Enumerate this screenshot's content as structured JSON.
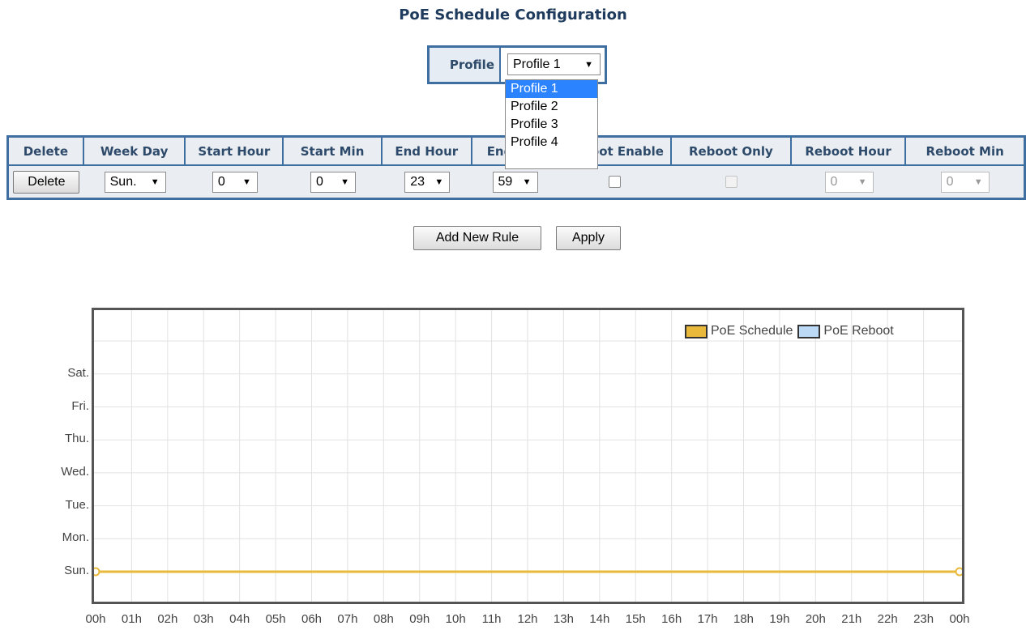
{
  "page": {
    "title": "PoE Schedule Configuration"
  },
  "profile": {
    "label": "Profile",
    "selected": "Profile 1",
    "options": [
      "Profile 1",
      "Profile 2",
      "Profile 3",
      "Profile 4"
    ]
  },
  "table": {
    "headers": [
      "Delete",
      "Week Day",
      "Start Hour",
      "Start Min",
      "End Hour",
      "End Min",
      "Reboot Enable",
      "Reboot Only",
      "Reboot Hour",
      "Reboot Min"
    ],
    "row": {
      "delete_label": "Delete",
      "week_day": "Sun.",
      "start_hour": "0",
      "start_min": "0",
      "end_hour": "23",
      "end_min": "59",
      "reboot_enable": false,
      "reboot_only": false,
      "reboot_hour": "0",
      "reboot_min": "0"
    }
  },
  "actions": {
    "add_label": "Add New Rule",
    "apply_label": "Apply"
  },
  "legend": {
    "schedule": {
      "label": "PoE Schedule",
      "color": "#e8b93a"
    },
    "reboot": {
      "label": "PoE Reboot",
      "color": "#bcd9f5"
    }
  },
  "chart_data": {
    "type": "line",
    "y_categories": [
      "Sun.",
      "Mon.",
      "Tue.",
      "Wed.",
      "Thu.",
      "Fri.",
      "Sat."
    ],
    "x_ticks": [
      "00h",
      "01h",
      "02h",
      "03h",
      "04h",
      "05h",
      "06h",
      "07h",
      "08h",
      "09h",
      "10h",
      "11h",
      "12h",
      "13h",
      "14h",
      "15h",
      "16h",
      "17h",
      "18h",
      "19h",
      "20h",
      "21h",
      "22h",
      "23h",
      "00h"
    ],
    "series": [
      {
        "name": "PoE Schedule",
        "color": "#e8b93a",
        "day": "Sun.",
        "start_hour": 0,
        "end_hour": 24
      }
    ],
    "grid": true,
    "legend_position": "top-right"
  }
}
